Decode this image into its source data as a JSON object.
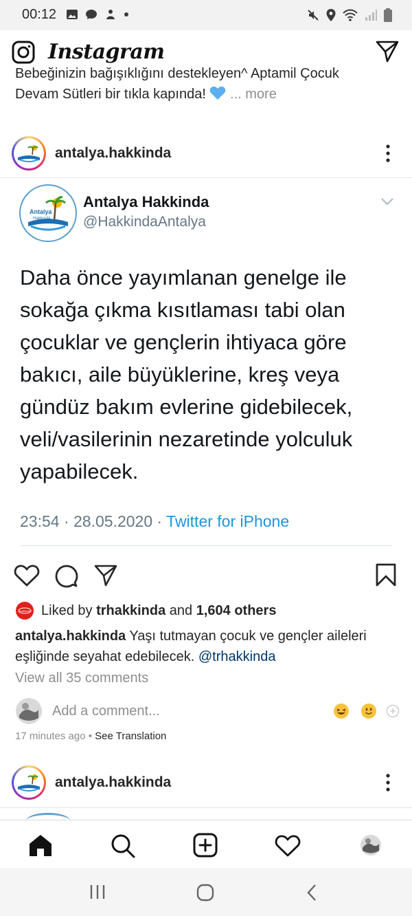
{
  "status_bar": {
    "time": "00:12"
  },
  "app": {
    "name": "Instagram"
  },
  "previous_post": {
    "caption_line1": "Bebeğinizin bağışıklığını destekleyen^ Aptamil Çocuk",
    "caption_line2": "Devam Sütleri bir tıkla kapında!",
    "more": "... more"
  },
  "post": {
    "username": "antalya.hakkinda",
    "avatar_text_line1": "Antalya",
    "avatar_text_line2": "Hakkında",
    "tweet": {
      "display_name": "Antalya Hakkinda",
      "handle": "@HakkindaAntalya",
      "text": "Daha önce yayımlanan genelge ile sokağa çıkma kısıtlaması tabi olan çocuklar ve gençlerin ihtiyaca göre bakıcı, aile büyüklerine, kreş veya gündüz bakım evlerine gidebilecek, veli/vasilerinin nezaretinde yolculuk yapabilecek.",
      "time": "23:54",
      "date": "28.05.2020",
      "source": "Twitter for iPhone",
      "sep": " · "
    },
    "liked_by_prefix": "Liked by",
    "liked_by_user": "trhakkinda",
    "liked_by_and": "and",
    "liked_by_others": "1,604 others",
    "liker_avatar_text": "trhakkinda",
    "caption_user": "antalya.hakkinda",
    "caption_text": "Yaşı tutmayan çocuk ve gençler aileleri eşliğinde seyahat edebilecek.",
    "caption_mention": "@trhakkinda",
    "view_all_comments": "View all 35 comments",
    "comment_placeholder": "Add a comment...",
    "time_ago": "17 minutes ago",
    "time_sep": " • ",
    "see_translation": "See Translation"
  },
  "next_post": {
    "username": "antalya.hakkinda"
  },
  "colors": {
    "link_blue": "#1b95e0",
    "mention_blue": "#00376b",
    "muted_gray": "#8e8e8e",
    "heart_emoji": "#5ab0f0"
  }
}
